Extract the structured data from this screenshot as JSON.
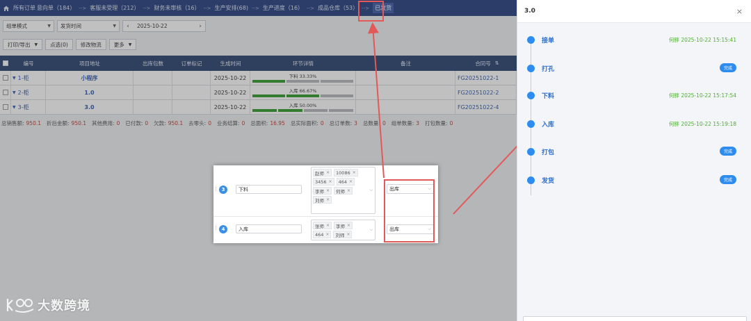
{
  "nav": {
    "items": [
      {
        "label": "所有订单",
        "active": false
      },
      {
        "label": "意向单（184）",
        "active": false
      },
      {
        "label": "客服未受理（212）",
        "active": false
      },
      {
        "label": "财务未审核（16）",
        "active": false
      },
      {
        "label": "生产安排(68)",
        "active": false
      },
      {
        "label": "生产进度（16）",
        "active": false
      },
      {
        "label": "成品仓库（53）",
        "active": false
      },
      {
        "label": "已发货",
        "active": true
      }
    ],
    "separator": "-->"
  },
  "toolbar": {
    "mode_select": "组单模式",
    "time_select": "发货时间",
    "date": "2025-10-22",
    "prev": "‹",
    "next": "›",
    "print_export": "打印/导出",
    "selected": "点选(0)",
    "modify_logistics": "修改物流",
    "more": "更多"
  },
  "table": {
    "headers": [
      "编号",
      "项目地址",
      "出库包数",
      "订单标记",
      "生成时间",
      "环节详情",
      "备注",
      "合同号"
    ],
    "rows": [
      {
        "no": "1-柜",
        "addr": "小程序",
        "time": "2025-10-22",
        "detail_label": "下料 33.33%",
        "progress": 0.3333,
        "contract": "FG20251022-1"
      },
      {
        "no": "2-柜",
        "addr": "1.0",
        "time": "2025-10-22",
        "detail_label": "入库 66.67%",
        "progress": 0.6667,
        "contract": "FG20251022-2"
      },
      {
        "no": "3-柜",
        "addr": "3.0",
        "time": "2025-10-22",
        "detail_label": "入库 50.00%",
        "progress": 0.5,
        "contract": "FG20251022-4"
      }
    ]
  },
  "summary": [
    {
      "label": "总销售额:",
      "value": "950.1"
    },
    {
      "label": "折后金额:",
      "value": "950.1"
    },
    {
      "label": "其他费用:",
      "value": "0"
    },
    {
      "label": "已付款:",
      "value": "0"
    },
    {
      "label": "欠款:",
      "value": "950.1"
    },
    {
      "label": "去零头:",
      "value": "0"
    },
    {
      "label": "业务结算:",
      "value": "0"
    },
    {
      "label": "总面积:",
      "value": "16.95"
    },
    {
      "label": "总实际面积:",
      "value": "0"
    },
    {
      "label": "总订单数:",
      "value": "3"
    },
    {
      "label": "总数量:",
      "value": "0"
    },
    {
      "label": "组单数量:",
      "value": "3"
    },
    {
      "label": "打包数量:",
      "value": "0"
    }
  ],
  "inset": {
    "rows": [
      {
        "step": "3",
        "name": "下料",
        "tags": [
          "赵师",
          "10086",
          "3456",
          "464",
          "李师",
          "何师",
          "刘师"
        ],
        "status": "出库"
      },
      {
        "step": "4",
        "name": "入库",
        "tags": [
          "张师",
          "李师",
          "464",
          "刘师"
        ],
        "status": "出库"
      }
    ]
  },
  "drawer": {
    "title": "3.0",
    "close": "×",
    "steps": [
      {
        "label": "接单",
        "time": "何胖 2025-10-22 15:15:41",
        "badge": ""
      },
      {
        "label": "打孔",
        "time": "",
        "badge": "完成"
      },
      {
        "label": "下料",
        "time": "何胖 2025-10-22 15:17:54",
        "badge": ""
      },
      {
        "label": "入库",
        "time": "何胖 2025-10-22 15:19:18",
        "badge": ""
      },
      {
        "label": "打包",
        "time": "",
        "badge": "完成"
      },
      {
        "label": "发货",
        "time": "",
        "badge": "完成"
      }
    ]
  },
  "watermark": {
    "text": "大数跨境"
  },
  "colors": {
    "nav_bg": "#243e7e",
    "header_bg": "#2a426f",
    "accent": "#2d8cf0",
    "highlight": "#e35858",
    "progress": "#2e9a2a"
  }
}
